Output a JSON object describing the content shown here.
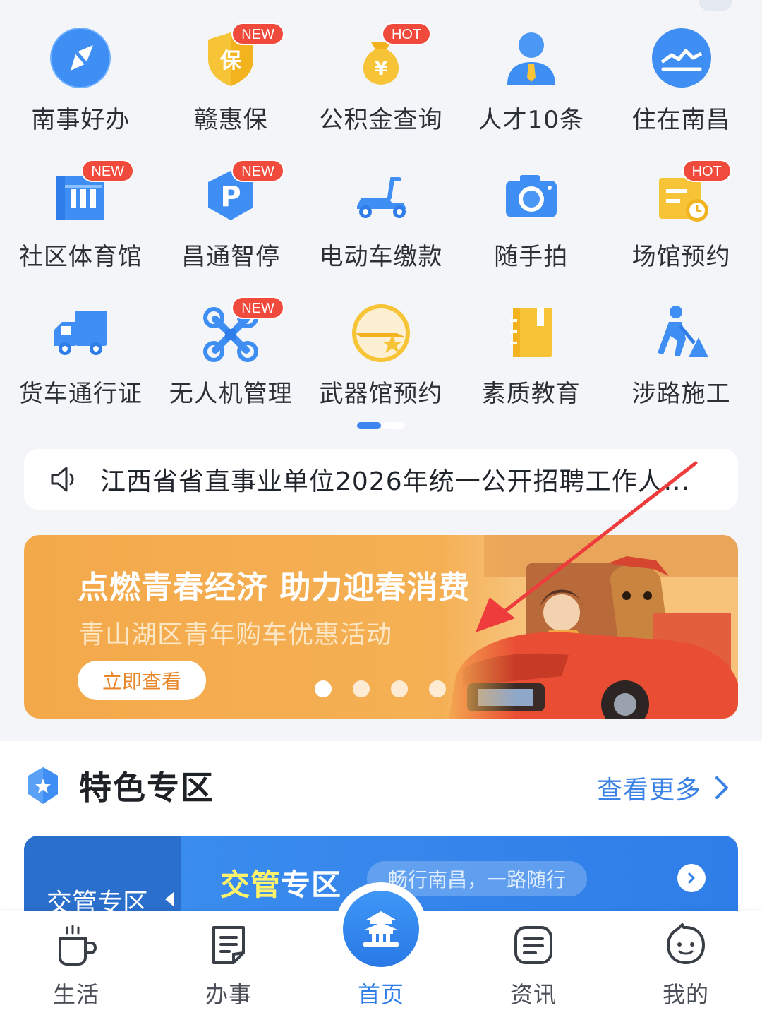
{
  "grid": {
    "rows": [
      [
        {
          "label": "南事好办",
          "icon": "compass-icon",
          "badge": ""
        },
        {
          "label": "赣惠保",
          "icon": "insurance-shield-icon",
          "badge": "NEW"
        },
        {
          "label": "公积金查询",
          "icon": "money-bag-icon",
          "badge": "HOT"
        },
        {
          "label": "人才10条",
          "icon": "talent-person-icon",
          "badge": ""
        },
        {
          "label": "住在南昌",
          "icon": "city-skyline-icon",
          "badge": ""
        }
      ],
      [
        {
          "label": "社区体育馆",
          "icon": "gym-building-icon",
          "badge": "NEW"
        },
        {
          "label": "昌通智停",
          "icon": "parking-icon",
          "badge": "NEW"
        },
        {
          "label": "电动车缴款",
          "icon": "electric-scooter-icon",
          "badge": ""
        },
        {
          "label": "随手拍",
          "icon": "camera-icon",
          "badge": ""
        },
        {
          "label": "场馆预约",
          "icon": "calendar-clock-icon",
          "badge": "HOT"
        }
      ],
      [
        {
          "label": "货车通行证",
          "icon": "truck-icon",
          "badge": ""
        },
        {
          "label": "无人机管理",
          "icon": "drone-icon",
          "badge": "NEW"
        },
        {
          "label": "武器馆预约",
          "icon": "weapon-museum-icon",
          "badge": ""
        },
        {
          "label": "素质教育",
          "icon": "notebook-icon",
          "badge": ""
        },
        {
          "label": "涉路施工",
          "icon": "road-construction-icon",
          "badge": ""
        }
      ]
    ],
    "page_index": 1,
    "page_count": 2
  },
  "notice": {
    "icon": "speaker-icon",
    "text": "江西省省直事业单位2026年统一公开招聘工作人..."
  },
  "banner": {
    "title": "点燃青春经济 助力迎春消费",
    "subtitle": "青山湖区青年购车优惠活动",
    "button": "立即查看",
    "slide_count": 4,
    "active_slide": 1
  },
  "section": {
    "title": "特色专区",
    "icon": "star-shield-icon",
    "more": "查看更多",
    "card": {
      "side_label": "交管专区",
      "title_highlight": "交管",
      "title_rest": "专区",
      "slogan": "畅行南昌，一路随行"
    }
  },
  "tabbar": {
    "items": [
      {
        "label": "生活",
        "icon": "coffee-cup-icon"
      },
      {
        "label": "办事",
        "icon": "document-icon"
      },
      {
        "label": "首页",
        "icon": "home-tengwang-icon"
      },
      {
        "label": "资讯",
        "icon": "news-icon"
      },
      {
        "label": "我的",
        "icon": "profile-face-icon"
      }
    ],
    "active": "首页"
  },
  "colors": {
    "accent": "#2f7de8",
    "badge": "#f04a3c",
    "banner": "#f3a94a"
  }
}
